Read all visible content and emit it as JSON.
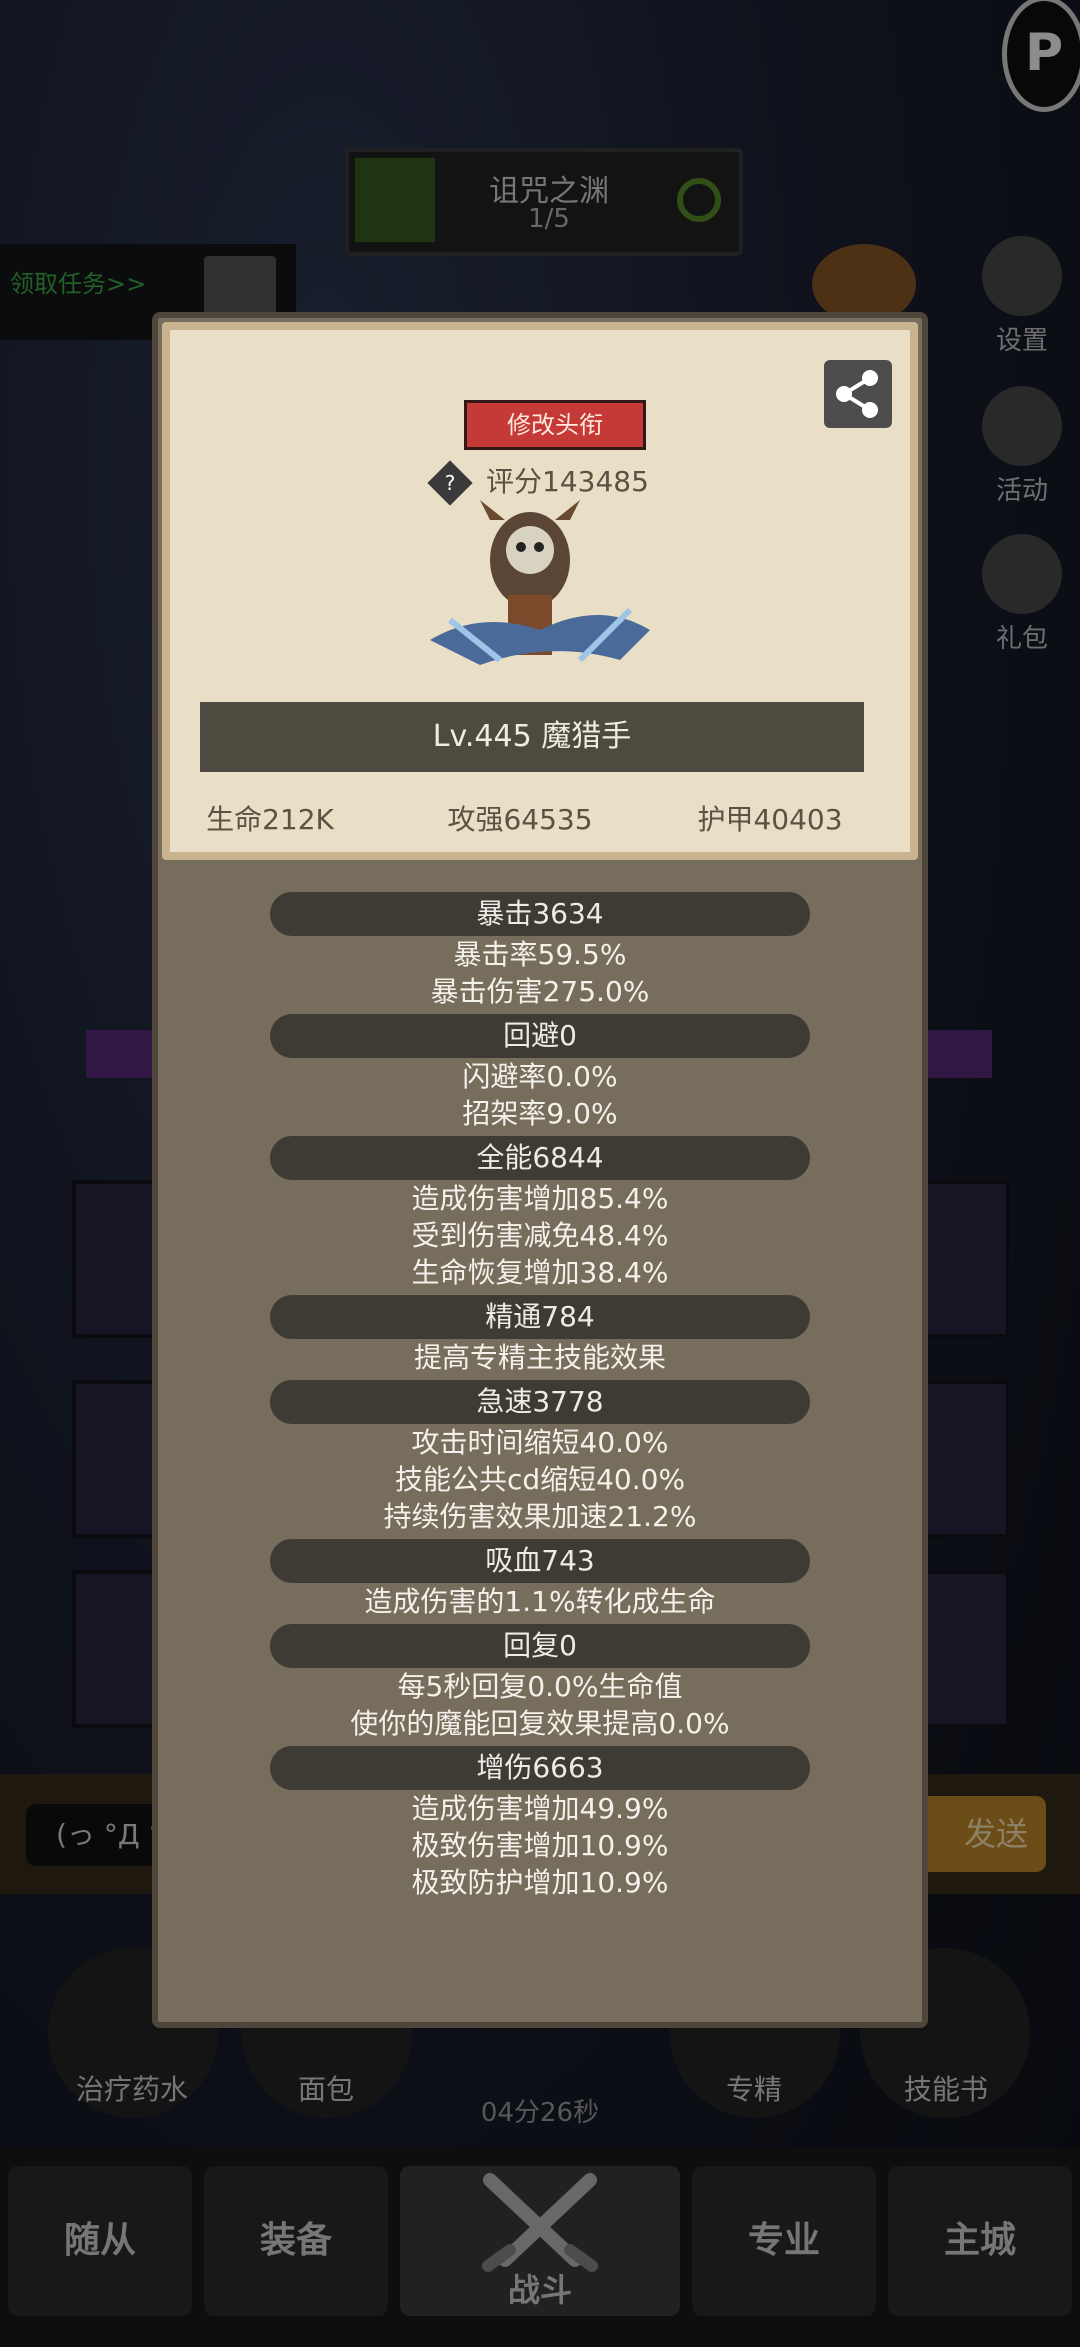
{
  "stage": {
    "title": "诅咒之渊",
    "progress": "1/5"
  },
  "quest": {
    "label": "领取任务>>"
  },
  "side_menu": [
    {
      "label": "设置",
      "icon": "gear-icon"
    },
    {
      "label": "活动",
      "icon": "scroll-icon"
    },
    {
      "label": "礼包",
      "icon": "gift-icon"
    }
  ],
  "popup": {
    "rename_button": "修改头衔",
    "score_label": "评分143485",
    "hero_name": "Lv.445 魔猎手",
    "base_stats": {
      "hp": "生命212K",
      "attack": "攻强64535",
      "armor": "护甲40403"
    },
    "sections": [
      {
        "title": "暴击3634",
        "lines": [
          "暴击率59.5%",
          "暴击伤害275.0%"
        ]
      },
      {
        "title": "回避0",
        "lines": [
          "闪避率0.0%",
          "招架率9.0%"
        ]
      },
      {
        "title": "全能6844",
        "lines": [
          "造成伤害增加85.4%",
          "受到伤害减免48.4%",
          "生命恢复增加38.4%"
        ]
      },
      {
        "title": "精通784",
        "lines": [
          "提高专精主技能效果"
        ]
      },
      {
        "title": "急速3778",
        "lines": [
          "攻击时间缩短40.0%",
          "技能公共cd缩短40.0%",
          "持续伤害效果加速21.2%"
        ]
      },
      {
        "title": "吸血743",
        "lines": [
          "造成伤害的1.1%转化成生命"
        ]
      },
      {
        "title": "回复0",
        "lines": [
          "每5秒回复0.0%生命值",
          "使你的魔能回复效果提高0.0%"
        ]
      },
      {
        "title": "增伤6663",
        "lines": [
          "造成伤害增加49.9%",
          "极致伤害增加10.9%",
          "极致防护增加10.9%"
        ]
      }
    ]
  },
  "chat": {
    "input_text": "(っ °Д °",
    "send_label": "发送"
  },
  "items": {
    "potion": "治疗药水",
    "bread": "面包",
    "spec": "专精",
    "skill_book": "技能书"
  },
  "timer": "04分26秒",
  "nav": {
    "followers": "随从",
    "equipment": "装备",
    "battle": "战斗",
    "profession": "专业",
    "city": "主城"
  }
}
